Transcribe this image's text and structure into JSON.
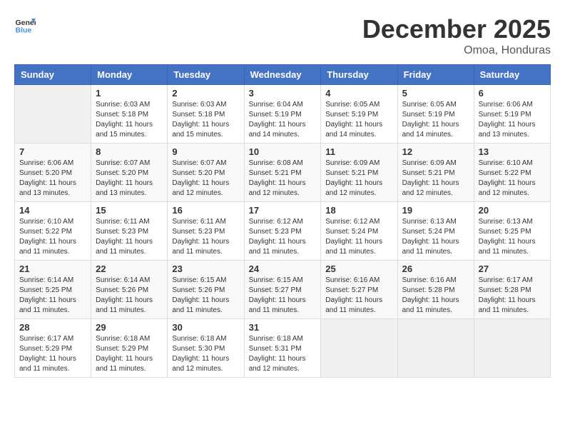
{
  "logo": {
    "general": "General",
    "blue": "Blue"
  },
  "title": "December 2025",
  "location": "Omoa, Honduras",
  "days_of_week": [
    "Sunday",
    "Monday",
    "Tuesday",
    "Wednesday",
    "Thursday",
    "Friday",
    "Saturday"
  ],
  "weeks": [
    [
      {
        "day": "",
        "info": ""
      },
      {
        "day": "1",
        "info": "Sunrise: 6:03 AM\nSunset: 5:18 PM\nDaylight: 11 hours\nand 15 minutes."
      },
      {
        "day": "2",
        "info": "Sunrise: 6:03 AM\nSunset: 5:18 PM\nDaylight: 11 hours\nand 15 minutes."
      },
      {
        "day": "3",
        "info": "Sunrise: 6:04 AM\nSunset: 5:19 PM\nDaylight: 11 hours\nand 14 minutes."
      },
      {
        "day": "4",
        "info": "Sunrise: 6:05 AM\nSunset: 5:19 PM\nDaylight: 11 hours\nand 14 minutes."
      },
      {
        "day": "5",
        "info": "Sunrise: 6:05 AM\nSunset: 5:19 PM\nDaylight: 11 hours\nand 14 minutes."
      },
      {
        "day": "6",
        "info": "Sunrise: 6:06 AM\nSunset: 5:19 PM\nDaylight: 11 hours\nand 13 minutes."
      }
    ],
    [
      {
        "day": "7",
        "info": "Sunrise: 6:06 AM\nSunset: 5:20 PM\nDaylight: 11 hours\nand 13 minutes."
      },
      {
        "day": "8",
        "info": "Sunrise: 6:07 AM\nSunset: 5:20 PM\nDaylight: 11 hours\nand 13 minutes."
      },
      {
        "day": "9",
        "info": "Sunrise: 6:07 AM\nSunset: 5:20 PM\nDaylight: 11 hours\nand 12 minutes."
      },
      {
        "day": "10",
        "info": "Sunrise: 6:08 AM\nSunset: 5:21 PM\nDaylight: 11 hours\nand 12 minutes."
      },
      {
        "day": "11",
        "info": "Sunrise: 6:09 AM\nSunset: 5:21 PM\nDaylight: 11 hours\nand 12 minutes."
      },
      {
        "day": "12",
        "info": "Sunrise: 6:09 AM\nSunset: 5:21 PM\nDaylight: 11 hours\nand 12 minutes."
      },
      {
        "day": "13",
        "info": "Sunrise: 6:10 AM\nSunset: 5:22 PM\nDaylight: 11 hours\nand 12 minutes."
      }
    ],
    [
      {
        "day": "14",
        "info": "Sunrise: 6:10 AM\nSunset: 5:22 PM\nDaylight: 11 hours\nand 11 minutes."
      },
      {
        "day": "15",
        "info": "Sunrise: 6:11 AM\nSunset: 5:23 PM\nDaylight: 11 hours\nand 11 minutes."
      },
      {
        "day": "16",
        "info": "Sunrise: 6:11 AM\nSunset: 5:23 PM\nDaylight: 11 hours\nand 11 minutes."
      },
      {
        "day": "17",
        "info": "Sunrise: 6:12 AM\nSunset: 5:23 PM\nDaylight: 11 hours\nand 11 minutes."
      },
      {
        "day": "18",
        "info": "Sunrise: 6:12 AM\nSunset: 5:24 PM\nDaylight: 11 hours\nand 11 minutes."
      },
      {
        "day": "19",
        "info": "Sunrise: 6:13 AM\nSunset: 5:24 PM\nDaylight: 11 hours\nand 11 minutes."
      },
      {
        "day": "20",
        "info": "Sunrise: 6:13 AM\nSunset: 5:25 PM\nDaylight: 11 hours\nand 11 minutes."
      }
    ],
    [
      {
        "day": "21",
        "info": "Sunrise: 6:14 AM\nSunset: 5:25 PM\nDaylight: 11 hours\nand 11 minutes."
      },
      {
        "day": "22",
        "info": "Sunrise: 6:14 AM\nSunset: 5:26 PM\nDaylight: 11 hours\nand 11 minutes."
      },
      {
        "day": "23",
        "info": "Sunrise: 6:15 AM\nSunset: 5:26 PM\nDaylight: 11 hours\nand 11 minutes."
      },
      {
        "day": "24",
        "info": "Sunrise: 6:15 AM\nSunset: 5:27 PM\nDaylight: 11 hours\nand 11 minutes."
      },
      {
        "day": "25",
        "info": "Sunrise: 6:16 AM\nSunset: 5:27 PM\nDaylight: 11 hours\nand 11 minutes."
      },
      {
        "day": "26",
        "info": "Sunrise: 6:16 AM\nSunset: 5:28 PM\nDaylight: 11 hours\nand 11 minutes."
      },
      {
        "day": "27",
        "info": "Sunrise: 6:17 AM\nSunset: 5:28 PM\nDaylight: 11 hours\nand 11 minutes."
      }
    ],
    [
      {
        "day": "28",
        "info": "Sunrise: 6:17 AM\nSunset: 5:29 PM\nDaylight: 11 hours\nand 11 minutes."
      },
      {
        "day": "29",
        "info": "Sunrise: 6:18 AM\nSunset: 5:29 PM\nDaylight: 11 hours\nand 11 minutes."
      },
      {
        "day": "30",
        "info": "Sunrise: 6:18 AM\nSunset: 5:30 PM\nDaylight: 11 hours\nand 12 minutes."
      },
      {
        "day": "31",
        "info": "Sunrise: 6:18 AM\nSunset: 5:31 PM\nDaylight: 11 hours\nand 12 minutes."
      },
      {
        "day": "",
        "info": ""
      },
      {
        "day": "",
        "info": ""
      },
      {
        "day": "",
        "info": ""
      }
    ]
  ]
}
